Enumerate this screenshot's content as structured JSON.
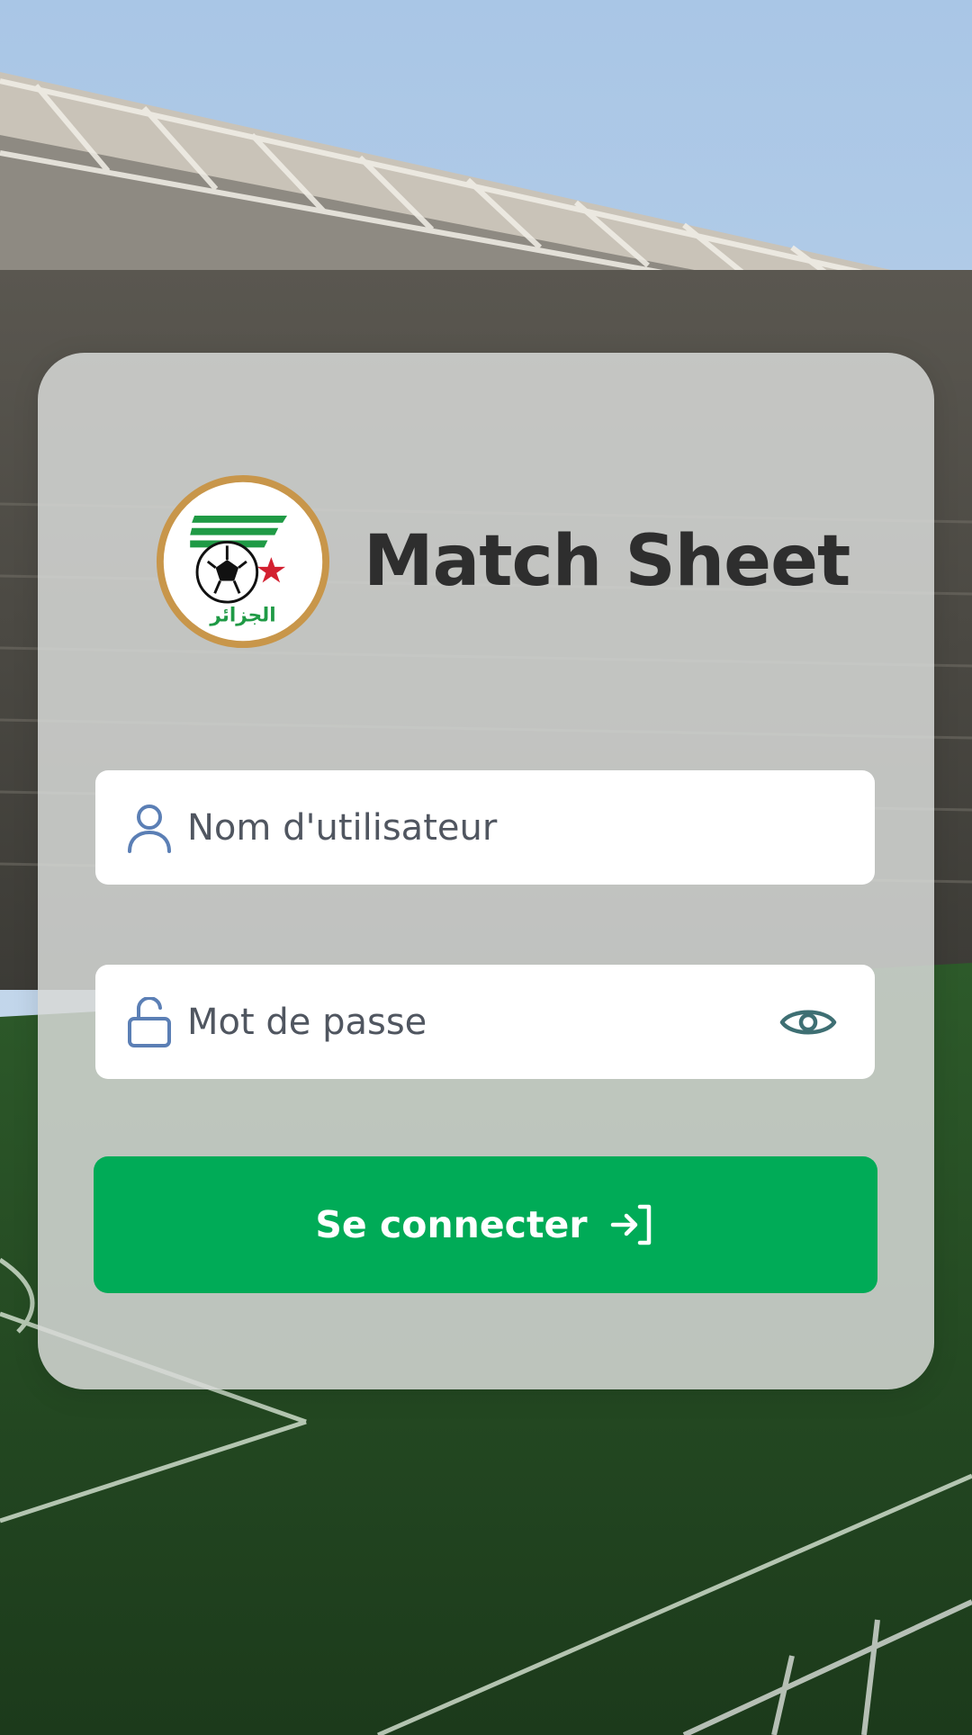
{
  "app": {
    "title": "Match Sheet",
    "logo_text": "الجزائر"
  },
  "login": {
    "username_placeholder": "Nom d'utilisateur",
    "username_value": "",
    "password_placeholder": "Mot de passe",
    "password_value": "",
    "submit_label": "Se connecter"
  },
  "icons": {
    "username": "user-icon",
    "password": "unlock-icon",
    "toggle_visibility": "eye-icon",
    "submit": "login-arrow-icon"
  },
  "colors": {
    "primary_green": "#00ab57",
    "title_text": "#2e2e2e",
    "icon_blue": "#5b7fb5",
    "eye_teal": "#3e6f73"
  }
}
